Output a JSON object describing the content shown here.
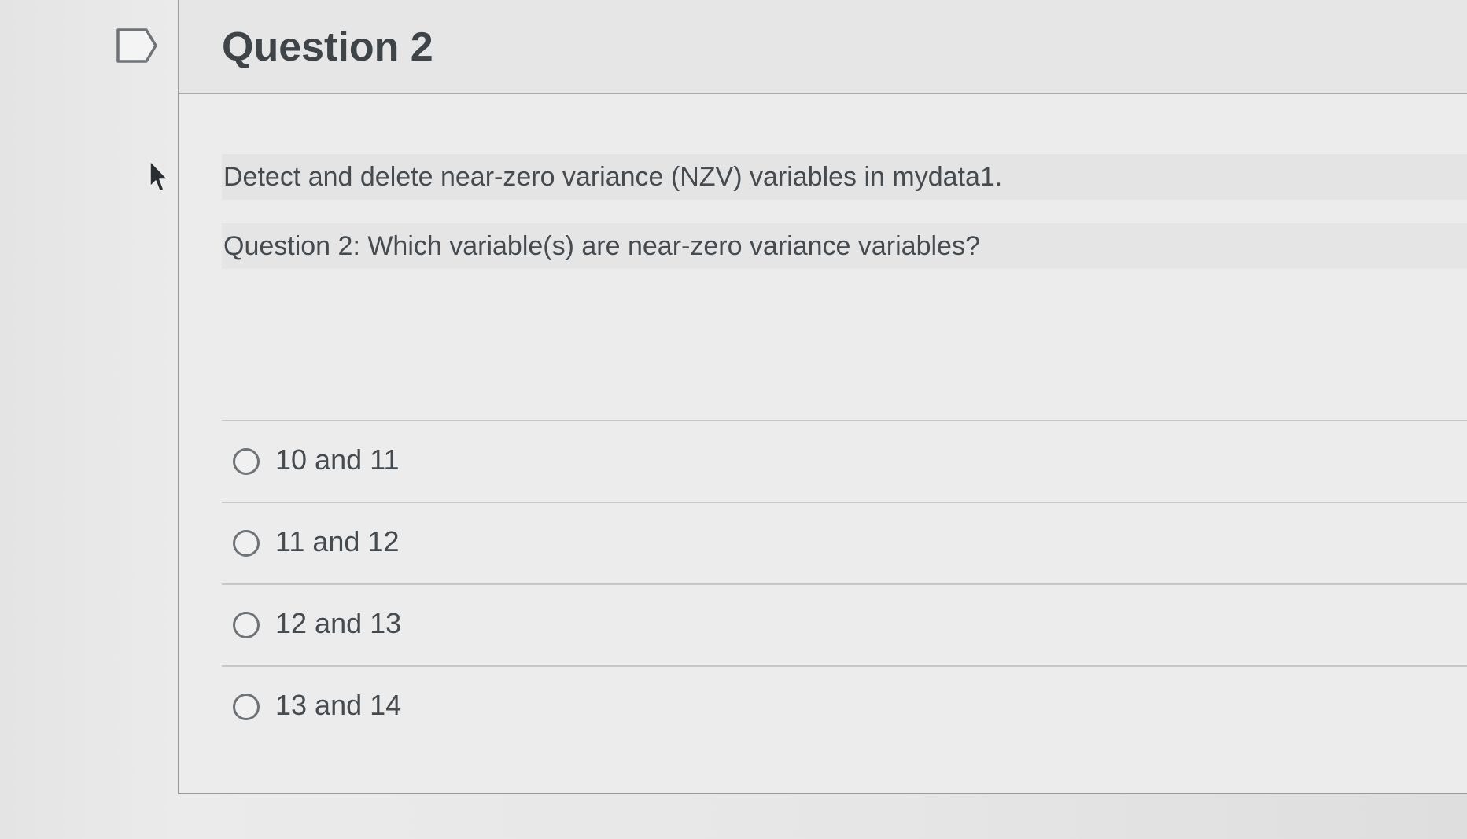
{
  "question": {
    "title": "Question 2",
    "flag_icon": "flag-outline-icon",
    "prompt_line1": "Detect and delete near-zero variance (NZV) variables in mydata1.",
    "prompt_line2": "Question 2: Which variable(s) are near-zero variance variables?"
  },
  "answers": [
    {
      "label": "10 and 11",
      "icon": "radio-unchecked-icon"
    },
    {
      "label": "11 and 12",
      "icon": "radio-unchecked-icon"
    },
    {
      "label": "12 and 13",
      "icon": "radio-unchecked-icon"
    },
    {
      "label": "13 and 14",
      "icon": "radio-unchecked-icon"
    }
  ],
  "colors": {
    "text": "#3f4449",
    "border": "#9a9a9a",
    "background": "#ececec"
  }
}
